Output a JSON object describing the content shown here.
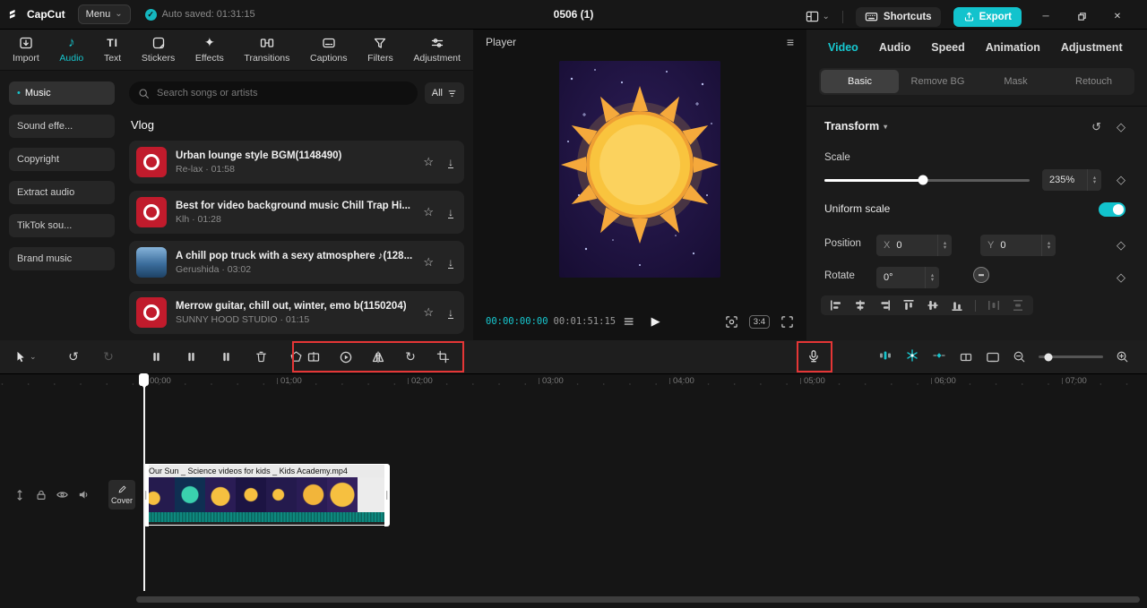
{
  "icons": {
    "caret_down": "⌄",
    "collapse": "▾",
    "stepper_up": "▴",
    "stepper_down": "▾",
    "check": "✓",
    "note": "♪",
    "text_tab": "TI",
    "sparkle": "✦",
    "star": "☆",
    "download": "↓",
    "play": "▶",
    "hamburger": "≡",
    "undo": "↺",
    "redo": "↻",
    "rotate": "↻",
    "diamond": "◇",
    "minimize": "─",
    "close": "✕",
    "bullet": "•"
  },
  "topbar": {
    "logo": "CapCut",
    "menu": "Menu",
    "autosave": "Auto saved: 01:31:15",
    "title": "0506 (1)",
    "shortcuts": "Shortcuts",
    "export": "Export"
  },
  "media_tabs": {
    "items": [
      {
        "label": "Import"
      },
      {
        "label": "Audio"
      },
      {
        "label": "Text"
      },
      {
        "label": "Stickers"
      },
      {
        "label": "Effects"
      },
      {
        "label": "Transitions"
      },
      {
        "label": "Captions"
      },
      {
        "label": "Filters"
      },
      {
        "label": "Adjustment"
      }
    ]
  },
  "library": {
    "sidebar": [
      {
        "label": "Music"
      },
      {
        "label": "Sound effe..."
      },
      {
        "label": "Copyright"
      },
      {
        "label": "Extract audio"
      },
      {
        "label": "TikTok sou..."
      },
      {
        "label": "Brand music"
      }
    ],
    "search_placeholder": "Search songs or artists",
    "filter": "All",
    "section": "Vlog",
    "songs": [
      {
        "title": "Urban lounge style BGM(1148490)",
        "meta": "Re-lax · 01:58"
      },
      {
        "title": "Best for video background music Chill Trap Hi...",
        "meta": "Klh · 01:28"
      },
      {
        "title": "A chill pop truck with a sexy atmosphere ♪(128...",
        "meta": "Gerushida · 03:02"
      },
      {
        "title": "Merrow guitar, chill out, winter, emo b(1150204)",
        "meta": "SUNNY HOOD STUDIO · 01:15"
      }
    ]
  },
  "player": {
    "title": "Player",
    "current": "00:00:00:00",
    "total": "00:01:51:15",
    "ratio": "3:4"
  },
  "inspector": {
    "tabs": [
      {
        "label": "Video"
      },
      {
        "label": "Audio"
      },
      {
        "label": "Speed"
      },
      {
        "label": "Animation"
      },
      {
        "label": "Adjustment"
      }
    ],
    "subtabs": [
      {
        "label": "Basic"
      },
      {
        "label": "Remove BG"
      },
      {
        "label": "Mask"
      },
      {
        "label": "Retouch"
      }
    ],
    "transform": {
      "title": "Transform",
      "scale_label": "Scale",
      "scale_value": "235%",
      "uniform_label": "Uniform scale",
      "position_label": "Position",
      "x_label": "X",
      "x_value": "0",
      "y_label": "Y",
      "y_value": "0",
      "rotate_label": "Rotate",
      "rotate_value": "0°"
    }
  },
  "timeline": {
    "ruler": [
      "00:00",
      "01:00",
      "02:00",
      "03:00",
      "04:00",
      "05:00",
      "06:00",
      "07:00"
    ],
    "cover": "Cover",
    "clip_title": "Our Sun _ Science videos for kids _ Kids Academy.mp4"
  }
}
